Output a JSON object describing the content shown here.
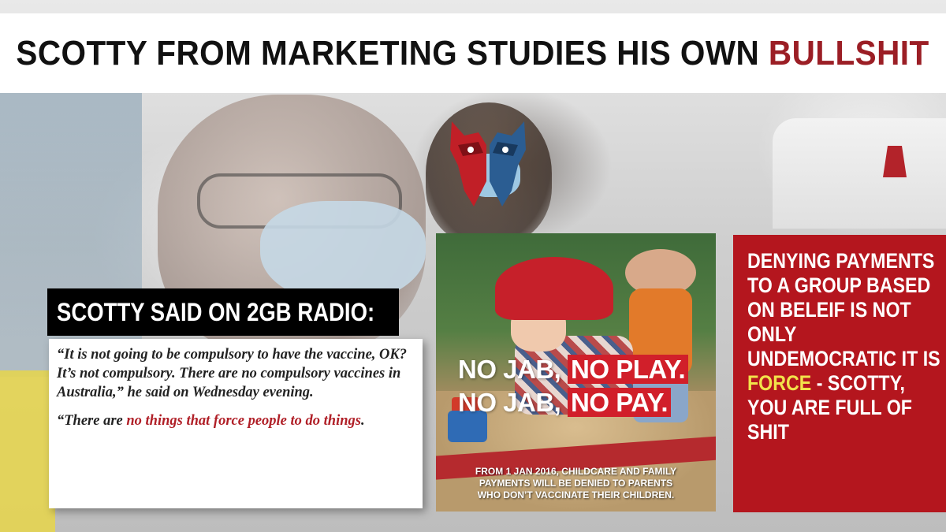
{
  "title": {
    "prefix": "SCOTTY FROM MARKETING STUDIES HIS OWN ",
    "accent": "BULLSHIT"
  },
  "quote_label": "SCOTTY SAID ON 2GB RADIO:",
  "quote": {
    "paragraph1": "“It is not going to be compulsory to have the vaccine, OK? It’s not compulsory. There are no compulsory vaccines in Australia,” he said on Wednesday evening.",
    "paragraph2_prefix": "“There are ",
    "paragraph2_highlight": "no things that force people to do things",
    "paragraph2_suffix": "."
  },
  "poster": {
    "line1_plain": "NO JAB, ",
    "line1_highlight": "NO PLAY.",
    "line2_plain": "NO JAB, ",
    "line2_highlight": "NO PAY.",
    "footer_line1": "FROM 1 JAN 2016, CHILDCARE AND FAMILY",
    "footer_line2": "PAYMENTS WILL BE DENIED TO PARENTS",
    "footer_line3": "WHO DON’T VACCINATE THEIR CHILDREN."
  },
  "red_panel": {
    "text_before": "DENYING PAYMENTS TO A GROUP BASED ON BELEIF IS NOT ONLY UNDEMOCRATIC IT IS ",
    "highlight": "FORCE",
    "text_after": " - SCOTTY, YOU ARE FULL OF SHIT"
  },
  "colors": {
    "accent_red": "#9b1e25",
    "panel_red": "#b4161e",
    "highlight_yellow": "#f2e24a",
    "quote_red": "#b01f27"
  },
  "icons": {
    "logo": "red-blue-owl-logo-icon"
  }
}
